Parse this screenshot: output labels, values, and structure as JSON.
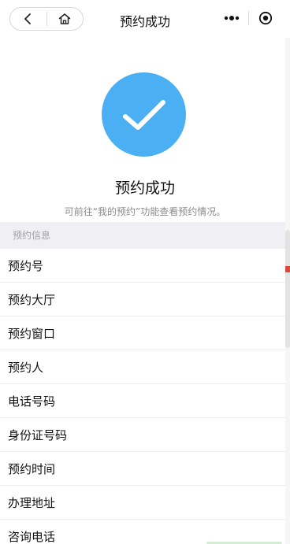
{
  "nav": {
    "title": "预约成功",
    "back_icon": "chevron-left-icon",
    "home_icon": "home-icon",
    "more_icon": "more-dots-icon",
    "close_icon": "record-circle-icon"
  },
  "success": {
    "icon": "checkmark-icon",
    "title": "预约成功",
    "description": "可前往“我的预约”功能查看预约情况。",
    "accent_color": "#4ab0f3"
  },
  "section": {
    "title": "预约信息"
  },
  "info_rows": [
    {
      "label": "预约号"
    },
    {
      "label": "预约大厅"
    },
    {
      "label": "预约窗口"
    },
    {
      "label": "预约人"
    },
    {
      "label": "电话号码"
    },
    {
      "label": "身份证号码"
    },
    {
      "label": "预约时间"
    },
    {
      "label": "办理地址"
    },
    {
      "label": "咨询电话"
    }
  ]
}
